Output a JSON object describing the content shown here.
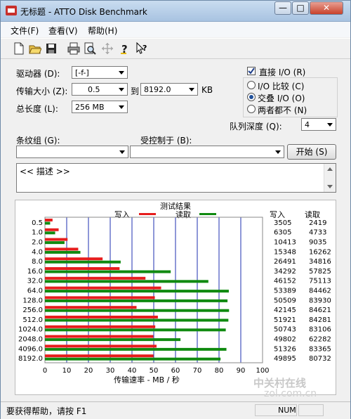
{
  "window": {
    "title": "无标题 - ATTO Disk Benchmark",
    "min": "—",
    "max": "□",
    "close": "✕"
  },
  "menu": [
    "文件(F)",
    "查看(V)",
    "帮助(H)"
  ],
  "toolbar_icons": [
    "new-icon",
    "open-icon",
    "save-icon",
    "print-icon",
    "print-preview-icon",
    "move-icon",
    "help-icon",
    "context-help-icon"
  ],
  "settings": {
    "drive_label": "驱动器 (D):",
    "drive_value": "[-f-]",
    "transfer_label": "传输大小 (Z):",
    "transfer_from": "0.5",
    "to_label": "到",
    "transfer_to": "8192.0",
    "kb": "KB",
    "length_label": "总长度 (L):",
    "length_value": "256 MB",
    "direct_io": "直接 I/O (R)",
    "radio_compare": "I/O 比较 (C)",
    "radio_overlap": "交叠 I/O (O)",
    "radio_neither": "两者都不 (N)",
    "queue_label": "队列深度 (Q):",
    "queue_value": "4",
    "stripe_label": "条纹组 (G):",
    "controlled_label": "受控制于 (B):",
    "start_button": "开始 (S)",
    "description": "<< 描述 >>"
  },
  "chart_data": {
    "type": "bar",
    "title": "测试结果",
    "xlabel": "传输速率 - MB / 秒",
    "xlim": [
      0,
      100
    ],
    "xticks": [
      "0",
      "10",
      "20",
      "30",
      "40",
      "50",
      "60",
      "70",
      "80",
      "90",
      "100"
    ],
    "categories": [
      "0.5",
      "1.0",
      "2.0",
      "4.0",
      "8.0",
      "16.0",
      "32.0",
      "64.0",
      "128.0",
      "256.0",
      "512.0",
      "1024.0",
      "2048.0",
      "4096.0",
      "8192.0"
    ],
    "series": [
      {
        "name": "写入",
        "color": "#e61d1d",
        "values": [
          3.5,
          6.3,
          10.4,
          15.3,
          26.5,
          34.3,
          46.2,
          53.4,
          50.5,
          42.1,
          51.9,
          50.7,
          49.8,
          51.3,
          49.9
        ]
      },
      {
        "name": "读取",
        "color": "#108a10",
        "values": [
          2.4,
          4.7,
          9.0,
          16.3,
          34.8,
          57.8,
          75.1,
          84.5,
          83.9,
          84.6,
          84.3,
          83.1,
          62.3,
          83.4,
          80.7
        ]
      }
    ],
    "write_header": "写入",
    "read_header": "读取",
    "write_values": [
      "3505",
      "6305",
      "10413",
      "15348",
      "26491",
      "34292",
      "46152",
      "53389",
      "50509",
      "42145",
      "51921",
      "50743",
      "49802",
      "51326",
      "49895"
    ],
    "read_values": [
      "2419",
      "4733",
      "9035",
      "16262",
      "34816",
      "57825",
      "75113",
      "84462",
      "83930",
      "84621",
      "84281",
      "83106",
      "62282",
      "83365",
      "80732"
    ]
  },
  "watermark": {
    "cn": "中关村在线",
    "en": "zol.com.cn"
  },
  "status": {
    "hint": "要获得帮助，请按 F1",
    "num": "NUM"
  }
}
